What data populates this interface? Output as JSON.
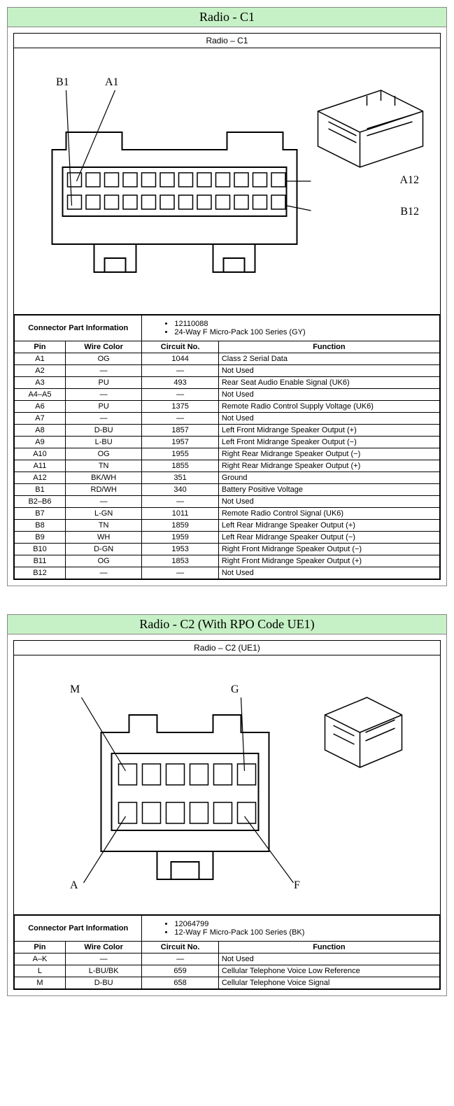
{
  "c1": {
    "panel_title": "Radio - C1",
    "inner_title": "Radio – C1",
    "labels": {
      "A1": "A1",
      "B1": "B1",
      "A12": "A12",
      "B12": "B12"
    },
    "part_label": "Connector Part Information",
    "part_num": "12110088",
    "part_desc": "24-Way F Micro-Pack 100 Series (GY)",
    "headers": {
      "pin": "Pin",
      "color": "Wire Color",
      "circuit": "Circuit No.",
      "func": "Function"
    },
    "rows": [
      {
        "pin": "A1",
        "color": "OG",
        "circuit": "1044",
        "func": "Class 2 Serial Data"
      },
      {
        "pin": "A2",
        "color": "—",
        "circuit": "—",
        "func": "Not Used"
      },
      {
        "pin": "A3",
        "color": "PU",
        "circuit": "493",
        "func": "Rear Seat Audio Enable Signal (UK6)"
      },
      {
        "pin": "A4–A5",
        "color": "—",
        "circuit": "—",
        "func": "Not Used"
      },
      {
        "pin": "A6",
        "color": "PU",
        "circuit": "1375",
        "func": "Remote Radio Control Supply Voltage (UK6)"
      },
      {
        "pin": "A7",
        "color": "—",
        "circuit": "—",
        "func": "Not Used"
      },
      {
        "pin": "A8",
        "color": "D-BU",
        "circuit": "1857",
        "func": "Left Front Midrange Speaker Output (+)"
      },
      {
        "pin": "A9",
        "color": "L-BU",
        "circuit": "1957",
        "func": "Left Front Midrange Speaker Output (−)"
      },
      {
        "pin": "A10",
        "color": "OG",
        "circuit": "1955",
        "func": "Right Rear Midrange Speaker Output (−)"
      },
      {
        "pin": "A11",
        "color": "TN",
        "circuit": "1855",
        "func": "Right Rear Midrange Speaker Output (+)"
      },
      {
        "pin": "A12",
        "color": "BK/WH",
        "circuit": "351",
        "func": "Ground"
      },
      {
        "pin": "B1",
        "color": "RD/WH",
        "circuit": "340",
        "func": "Battery Positive Voltage"
      },
      {
        "pin": "B2–B6",
        "color": "—",
        "circuit": "—",
        "func": "Not Used"
      },
      {
        "pin": "B7",
        "color": "L-GN",
        "circuit": "1011",
        "func": "Remote Radio Control Signal (UK6)"
      },
      {
        "pin": "B8",
        "color": "TN",
        "circuit": "1859",
        "func": "Left Rear Midrange Speaker Output (+)"
      },
      {
        "pin": "B9",
        "color": "WH",
        "circuit": "1959",
        "func": "Left Rear Midrange Speaker Output (−)"
      },
      {
        "pin": "B10",
        "color": "D-GN",
        "circuit": "1953",
        "func": "Right Front Midrange Speaker Output (−)"
      },
      {
        "pin": "B11",
        "color": "OG",
        "circuit": "1853",
        "func": "Right Front Midrange Speaker Output (+)"
      },
      {
        "pin": "B12",
        "color": "—",
        "circuit": "—",
        "func": "Not Used"
      }
    ]
  },
  "c2": {
    "panel_title": "Radio - C2 (With RPO Code UE1)",
    "inner_title": "Radio – C2 (UE1)",
    "labels": {
      "M": "M",
      "G": "G",
      "A": "A",
      "F": "F"
    },
    "part_label": "Connector Part Information",
    "part_num": "12064799",
    "part_desc": "12-Way F Micro-Pack 100 Series (BK)",
    "headers": {
      "pin": "Pin",
      "color": "Wire Color",
      "circuit": "Circuit No.",
      "func": "Function"
    },
    "rows": [
      {
        "pin": "A–K",
        "color": "—",
        "circuit": "—",
        "func": "Not Used"
      },
      {
        "pin": "L",
        "color": "L-BU/BK",
        "circuit": "659",
        "func": "Cellular Telephone Voice Low Reference"
      },
      {
        "pin": "M",
        "color": "D-BU",
        "circuit": "658",
        "func": "Cellular Telephone Voice Signal"
      }
    ]
  }
}
